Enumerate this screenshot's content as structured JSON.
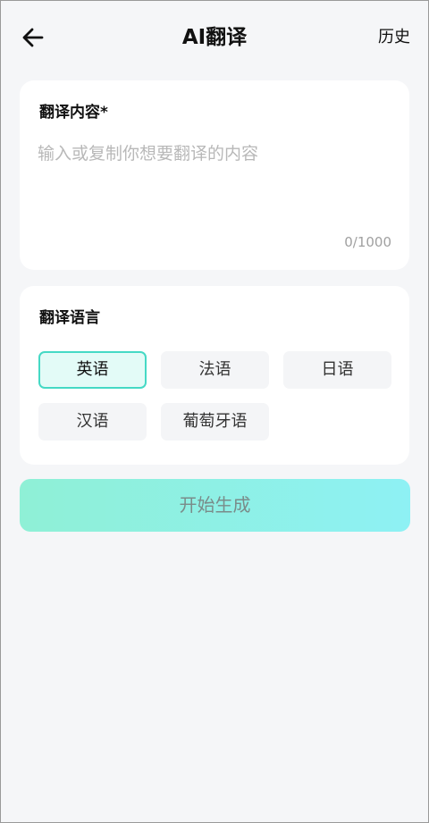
{
  "header": {
    "title": "AI翻译",
    "history_label": "历史",
    "back_icon": "arrow-left-icon"
  },
  "content_card": {
    "title": "翻译内容*",
    "input_value": "",
    "placeholder": "输入或复制你想要翻译的内容",
    "counter": "0/1000"
  },
  "language_card": {
    "title": "翻译语言",
    "selected": "英语",
    "options": [
      "英语",
      "法语",
      "日语",
      "汉语",
      "葡萄牙语"
    ]
  },
  "actions": {
    "start_label": "开始生成"
  },
  "colors": {
    "background": "#f5f6f8",
    "card": "#ffffff",
    "selected_border": "#45d9c5",
    "selected_fill": "#e3fbf7",
    "button_gradient_start": "#8ff0d6",
    "button_gradient_end": "#8ef1f4"
  }
}
